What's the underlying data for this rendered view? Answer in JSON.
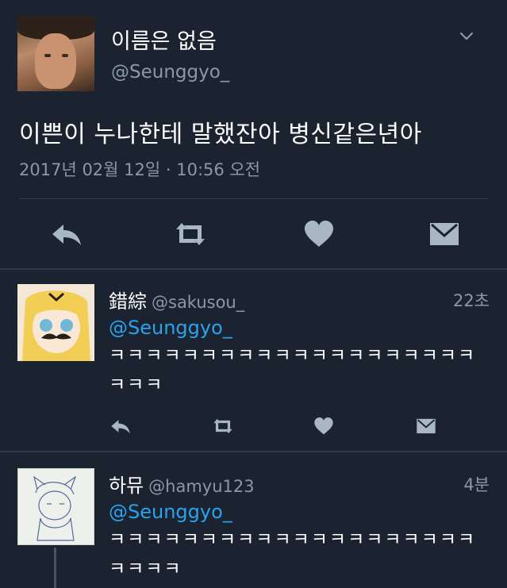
{
  "main_tweet": {
    "display_name": "이름은 없음",
    "handle": "@Seunggyo_",
    "text": "이쁜이 누나한테 말했잔아 병신같은년아",
    "timestamp": "2017년 02월 12일 · 10:56 오전"
  },
  "replies": [
    {
      "display_name": "錯綜",
      "handle": "@sakusou_",
      "time": "22초",
      "mention": "@Seunggyo_",
      "text": "ㅋㅋㅋㅋㅋㅋㅋㅋㅋㅋㅋㅋㅋㅋㅋㅋㅋㅋㅋㅋㅋㅋㅋ"
    },
    {
      "display_name": "하뮤",
      "handle": "@hamyu123",
      "time": "4분",
      "mention": "@Seunggyo_",
      "text": "ㅋㅋㅋㅋㅋㅋㅋㅋㅋㅋㅋㅋㅋㅋㅋㅋㅋㅋㅋㅋㅋㅋㅋㅋ"
    }
  ],
  "icons": [
    "reply-icon",
    "retweet-icon",
    "like-icon",
    "message-icon",
    "chevron-down-icon"
  ],
  "colors": {
    "background": "#1b2330",
    "mention": "#2aa3ef",
    "muted": "#8a98a8",
    "icon": "#a9b6c4"
  }
}
